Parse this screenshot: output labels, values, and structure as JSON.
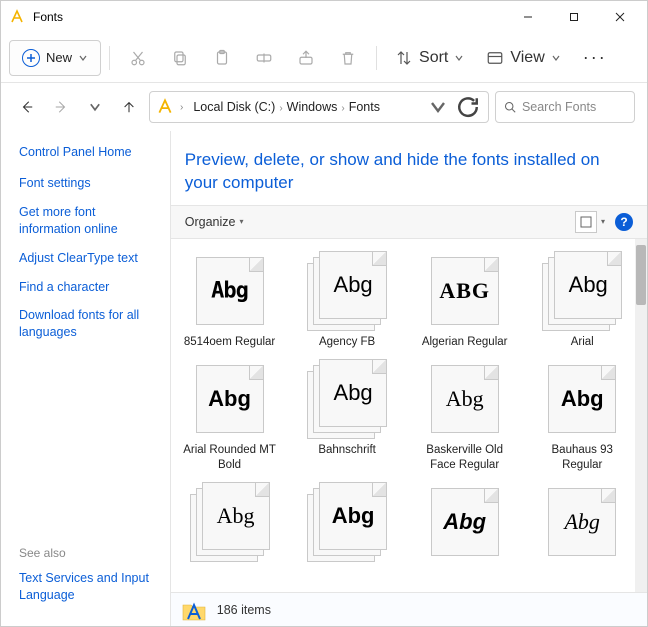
{
  "window": {
    "title": "Fonts"
  },
  "toolbar": {
    "new_label": "New",
    "sort_label": "Sort",
    "view_label": "View"
  },
  "breadcrumbs": {
    "items": [
      "Local Disk (C:)",
      "Windows",
      "Fonts"
    ]
  },
  "search": {
    "placeholder": "Search Fonts"
  },
  "sidebar": {
    "home": "Control Panel Home",
    "links": [
      "Font settings",
      "Get more font information online",
      "Adjust ClearType text",
      "Find a character",
      "Download fonts for all languages"
    ],
    "see_also_label": "See also",
    "see_also": [
      "Text Services and Input Language"
    ]
  },
  "page": {
    "heading": "Preview, delete, or show and hide the fonts installed on your computer",
    "organize_label": "Organize"
  },
  "fonts": [
    {
      "name": "8514oem Regular",
      "sample": "Abg",
      "stack": false,
      "style": "sample-pixel"
    },
    {
      "name": "Agency FB",
      "sample": "Abg",
      "stack": true,
      "style": "sample-condensed"
    },
    {
      "name": "Algerian Regular",
      "sample": "ABG",
      "stack": false,
      "style": "sample-serif-caps"
    },
    {
      "name": "Arial",
      "sample": "Abg",
      "stack": true,
      "style": "sample-default"
    },
    {
      "name": "Arial Rounded MT Bold",
      "sample": "Abg",
      "stack": false,
      "style": "sample-rounded"
    },
    {
      "name": "Bahnschrift",
      "sample": "Abg",
      "stack": true,
      "style": "sample-light"
    },
    {
      "name": "Baskerville Old Face Regular",
      "sample": "Abg",
      "stack": false,
      "style": "sample-serif"
    },
    {
      "name": "Bauhaus 93 Regular",
      "sample": "Abg",
      "stack": false,
      "style": "sample-heavy"
    },
    {
      "name": "",
      "sample": "Abg",
      "stack": true,
      "style": "sample-serif2"
    },
    {
      "name": "",
      "sample": "Abg",
      "stack": true,
      "style": "sample-rounded"
    },
    {
      "name": "",
      "sample": "Abg",
      "stack": false,
      "style": "sample-impact"
    },
    {
      "name": "",
      "sample": "Abg",
      "stack": false,
      "style": "sample-script"
    }
  ],
  "status": {
    "count_text": "186 items"
  }
}
